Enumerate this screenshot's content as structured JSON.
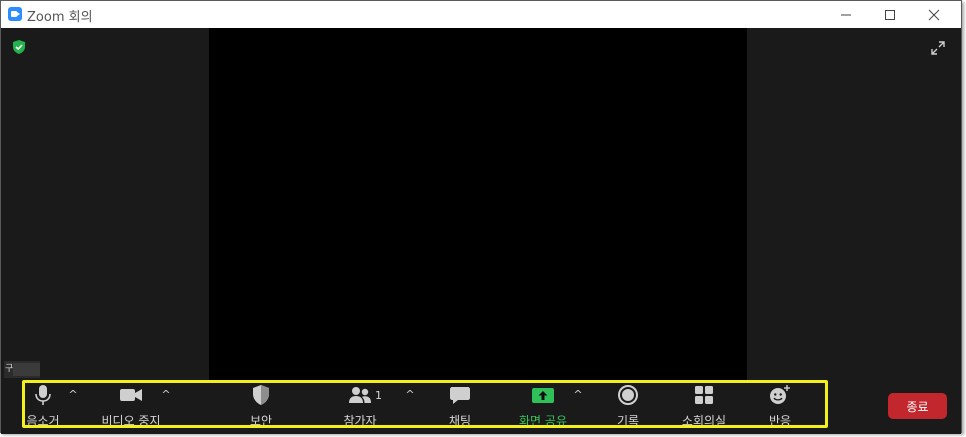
{
  "window": {
    "title": "Zoom 회의"
  },
  "colors": {
    "accent": "#2d8cff",
    "highlight": "#f2ef1a",
    "end": "#c1272d",
    "share": "#35c25a"
  },
  "icons": {
    "app": "zoom-camera-icon",
    "security_badge": "shield-check-icon",
    "fullscreen": "expand-icon"
  },
  "participant": {
    "name_initial": "구"
  },
  "toolbar": {
    "mute": {
      "label": "음소거",
      "icon": "microphone-icon"
    },
    "video": {
      "label": "비디오 중지",
      "icon": "video-camera-icon"
    },
    "security": {
      "label": "보안",
      "icon": "shield-icon"
    },
    "participants": {
      "label": "참가자",
      "icon": "people-icon",
      "count": "1"
    },
    "chat": {
      "label": "채팅",
      "icon": "chat-bubble-icon"
    },
    "share": {
      "label": "화면 공유",
      "icon": "share-screen-icon"
    },
    "record": {
      "label": "기록",
      "icon": "record-icon"
    },
    "breakout": {
      "label": "소회의실",
      "icon": "grid-icon"
    },
    "reactions": {
      "label": "반응",
      "icon": "smiley-add-icon"
    },
    "end_label": "종료"
  }
}
